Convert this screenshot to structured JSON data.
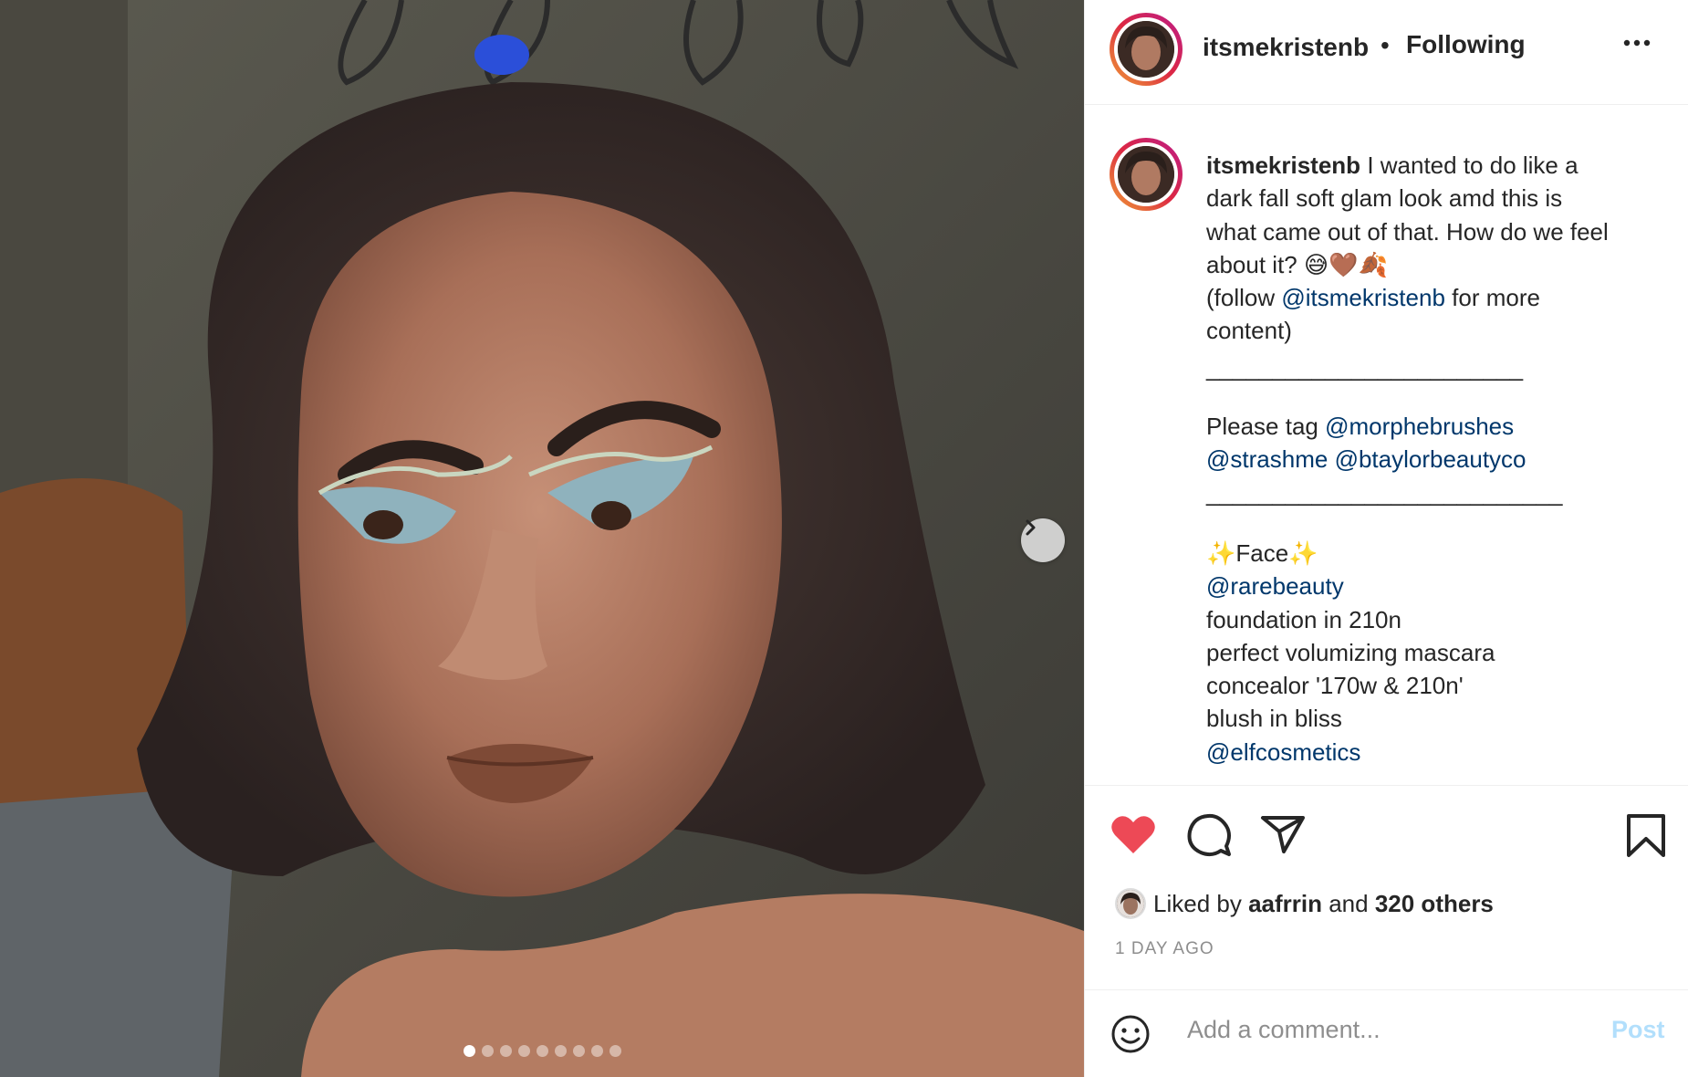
{
  "post": {
    "username": "itsmekristenb",
    "separator": "•",
    "follow_status": "Following",
    "more_icon": "more-horizontal-icon",
    "image_alt": "Selfie with blue graphic eyeliner and soft glam makeup",
    "carousel": {
      "total": 9,
      "active_index": 0
    }
  },
  "caption": {
    "username": "itsmekristenb",
    "lines": [
      "I wanted to do like a",
      "dark fall soft glam look amd this is",
      "what came out of that. How do we feel",
      "about it? 😅🤎🍂",
      "(follow ",
      "@itsmekristenb",
      " for more",
      "content)",
      "________________________",
      "Please tag ",
      "@morphebrushes",
      "@strashme",
      "@btaylorbeautyco",
      "___________________________",
      "✨Face✨",
      "@rarebeauty",
      "foundation in 210n",
      "perfect volumizing mascara",
      "concealor '170w & 210n'",
      "blush in bliss",
      "@elfcosmetics"
    ]
  },
  "actions": {
    "like_icon": "heart-filled-icon",
    "comment_icon": "comment-icon",
    "share_icon": "share-icon",
    "save_icon": "bookmark-icon",
    "like_color": "#ed4956"
  },
  "likes": {
    "prefix": "Liked by ",
    "user": "aafrrin",
    "middle": " and ",
    "others": "320 others"
  },
  "timestamp": "1 DAY AGO",
  "comment": {
    "placeholder": "Add a comment...",
    "post_label": "Post",
    "emoji_icon": "emoji-icon",
    "post_color": "#b2dffc"
  }
}
